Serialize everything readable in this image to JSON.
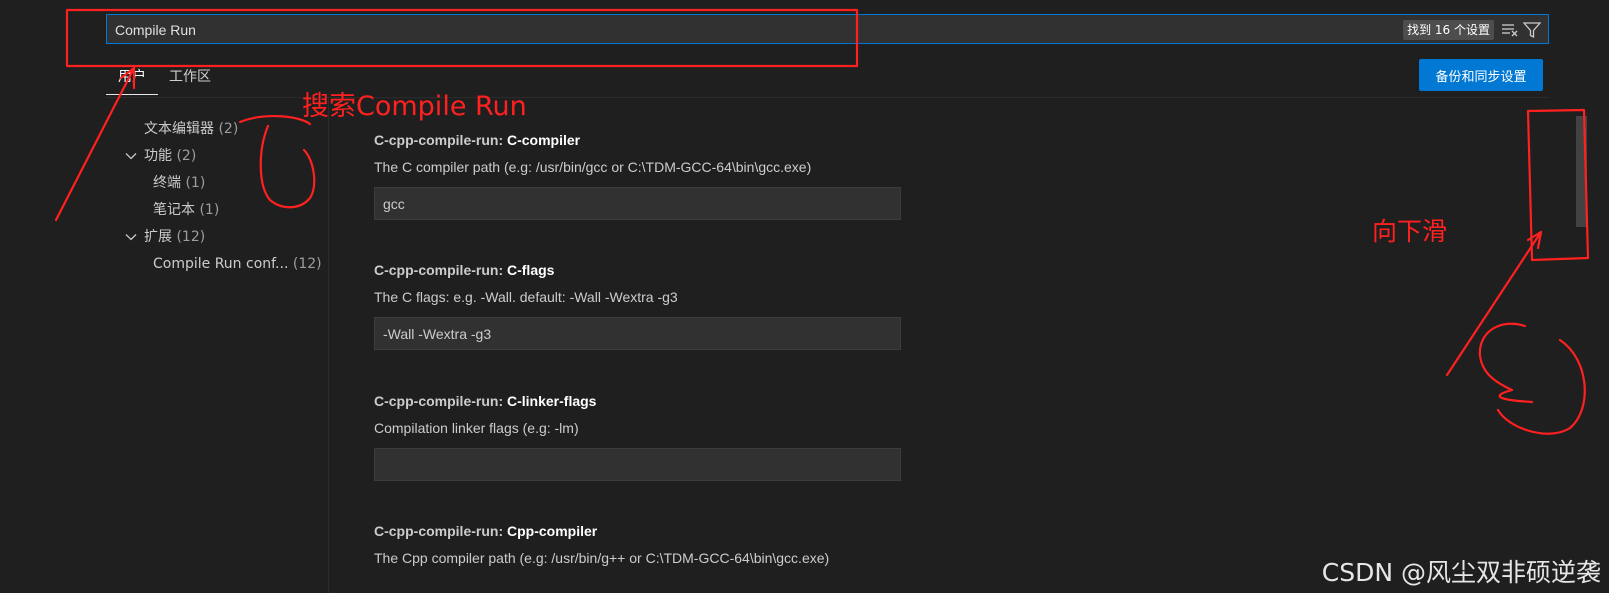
{
  "search": {
    "value": "Compile Run",
    "found_count": "找到 16 个设置"
  },
  "tabs": [
    {
      "label": "用户",
      "active": true
    },
    {
      "label": "工作区",
      "active": false
    }
  ],
  "sync_button": "备份和同步设置",
  "toc": [
    {
      "label": "文本编辑器",
      "count": "(2)",
      "expandable": false
    },
    {
      "label": "功能",
      "count": "(2)",
      "expandable": true
    },
    {
      "label": "终端",
      "count": "(1)",
      "expandable": false
    },
    {
      "label": "笔记本",
      "count": "(1)",
      "expandable": false
    },
    {
      "label": "扩展",
      "count": "(12)",
      "expandable": true
    },
    {
      "label": "Compile Run conf...",
      "count": "(12)",
      "expandable": false
    }
  ],
  "settings": [
    {
      "prefix": "C-cpp-compile-run: ",
      "key": "C-compiler",
      "desc": "The C compiler path (e.g: /usr/bin/gcc or C:\\TDM-GCC-64\\bin\\gcc.exe)",
      "value": "gcc"
    },
    {
      "prefix": "C-cpp-compile-run: ",
      "key": "C-flags",
      "desc": "The C flags: e.g. -Wall. default: -Wall -Wextra -g3",
      "value": "-Wall -Wextra -g3"
    },
    {
      "prefix": "C-cpp-compile-run: ",
      "key": "C-linker-flags",
      "desc": "Compilation linker flags (e.g: -lm)",
      "value": ""
    },
    {
      "prefix": "C-cpp-compile-run: ",
      "key": "Cpp-compiler",
      "desc": "The Cpp compiler path (e.g: /usr/bin/g++ or C:\\TDM-GCC-64\\bin\\gcc.exe)",
      "value": ""
    }
  ],
  "annotations": {
    "search_note": "搜索Compile Run",
    "scroll_note": "向下滑",
    "color": "#ff2020"
  },
  "watermark": "CSDN @风尘双非硕逆袭",
  "colors": {
    "background": "#1f1f1f",
    "accent": "#0078d4",
    "input_bg": "#313131"
  }
}
